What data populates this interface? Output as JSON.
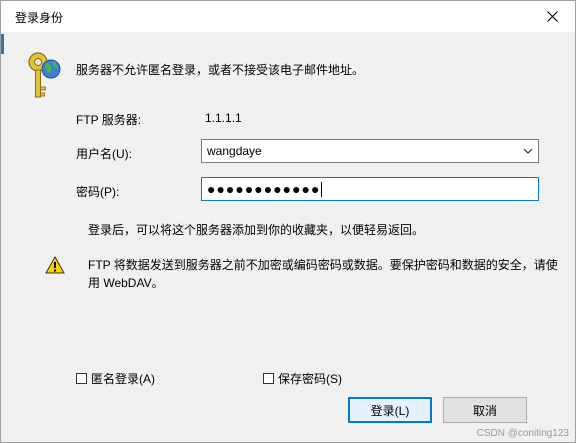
{
  "title": "登录身份",
  "message": "服务器不允许匿名登录，或者不接受该电子邮件地址。",
  "ftp_server": {
    "label": "FTP 服务器:",
    "value": "1.1.1.1"
  },
  "username": {
    "label": "用户名(U):",
    "value": "wangdaye"
  },
  "password": {
    "label": "密码(P):",
    "masked": "●●●●●●●●●●●●"
  },
  "info_text": "登录后，可以将这个服务器添加到你的收藏夹，以便轻易返回。",
  "warning_text": "FTP 将数据发送到服务器之前不加密或编码密码或数据。要保护密码和数据的安全，请使用 WebDAV。",
  "checkboxes": {
    "anonymous": {
      "label": "匿名登录(A)",
      "checked": false
    },
    "save_password": {
      "label": "保存密码(S)",
      "checked": false
    }
  },
  "buttons": {
    "login": "登录(L)",
    "cancel": "取消"
  },
  "watermark": "CSDN @coniting123",
  "colors": {
    "focus": "#0078d7",
    "dialog_bg": "#f0f0f0"
  },
  "icons": {
    "header": "keys-globe-icon",
    "warning": "warning-triangle-icon",
    "close": "close-icon",
    "dropdown": "chevron-down-icon"
  }
}
